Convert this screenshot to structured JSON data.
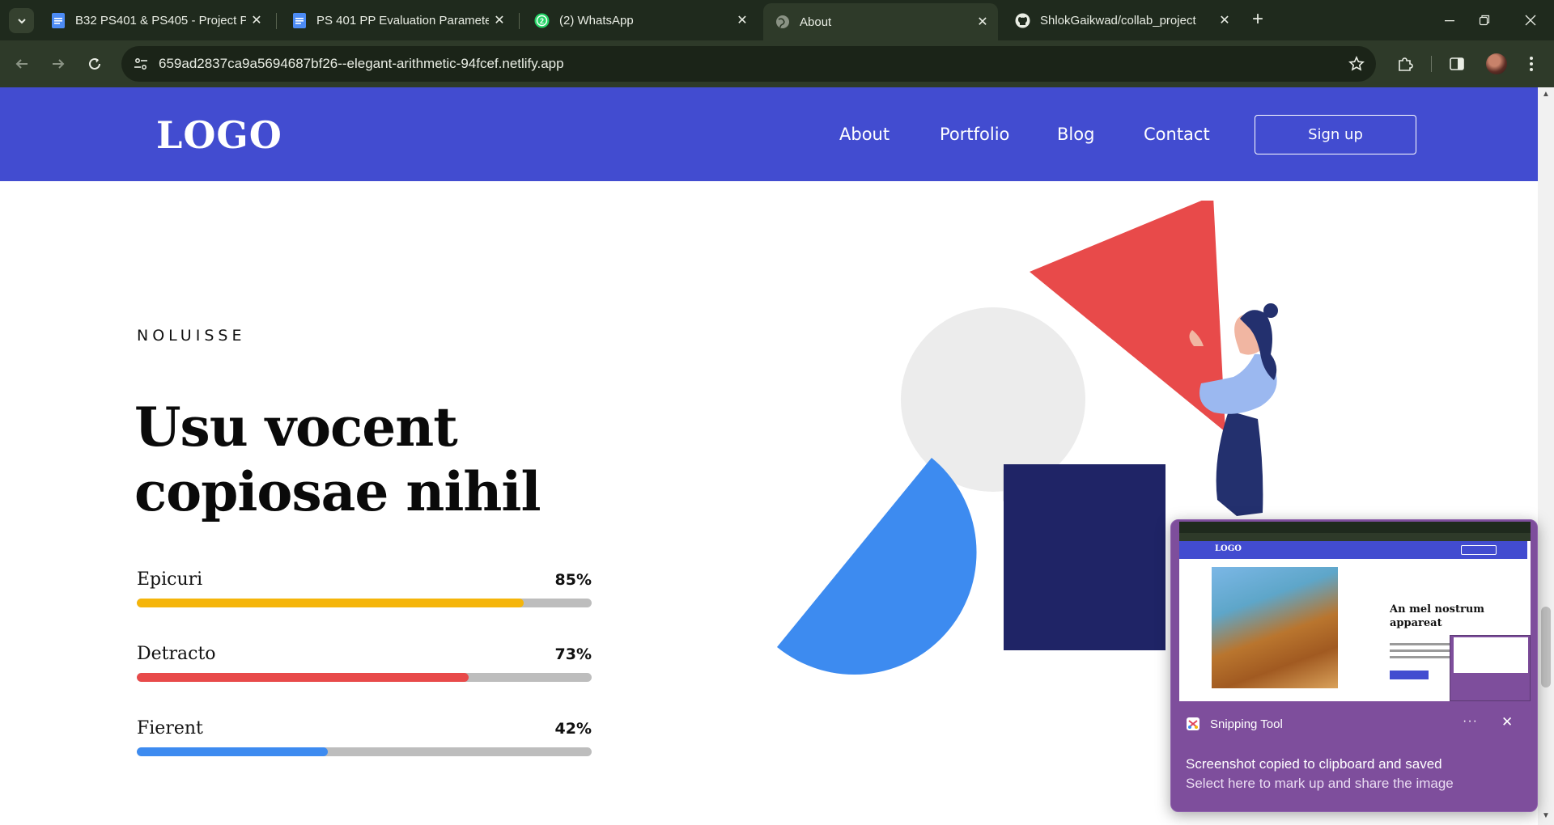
{
  "browser": {
    "tabs": [
      {
        "title": "B32 PS401 & PS405 - Project Pr",
        "icon": "docs-icon",
        "active": false
      },
      {
        "title": "PS 401 PP Evaluation Parameter",
        "icon": "docs-icon",
        "active": false
      },
      {
        "title": "(2) WhatsApp",
        "icon": "whatsapp-icon",
        "badge": "2",
        "active": false
      },
      {
        "title": "About",
        "icon": "globe-icon",
        "active": true
      },
      {
        "title": "ShlokGaikwad/collab_project",
        "icon": "github-icon",
        "active": false
      }
    ],
    "url": "659ad2837ca9a5694687bf26--elegant-arithmetic-94fcef.netlify.app",
    "colors": {
      "frame": "#1f2a1d",
      "toolbar": "#2e3a29"
    }
  },
  "site": {
    "logo": "LOGO",
    "nav": {
      "about": "About",
      "portfolio": "Portfolio",
      "blog": "Blog",
      "contact": "Contact"
    },
    "signup_label": "Sign up",
    "header_color": "#424cd0"
  },
  "hero": {
    "eyebrow": "NOLUISSE",
    "headline_line1": "Usu vocent",
    "headline_line2": "copiosae nihil"
  },
  "skills": [
    {
      "name": "Epicuri",
      "percent_label": "85%",
      "percent": 85,
      "color": "#f5b50a"
    },
    {
      "name": "Detracto",
      "percent_label": "73%",
      "percent": 73,
      "color": "#e84a4a"
    },
    {
      "name": "Fierent",
      "percent_label": "42%",
      "percent": 42,
      "color": "#3d8bf0"
    }
  ],
  "snip": {
    "app_name": "Snipping Tool",
    "line1": "Screenshot copied to clipboard and saved",
    "line2": "Select here to mark up and share the image",
    "thumbnail": {
      "logo": "LOGO",
      "heading": "An mel nostrum appareat"
    }
  }
}
